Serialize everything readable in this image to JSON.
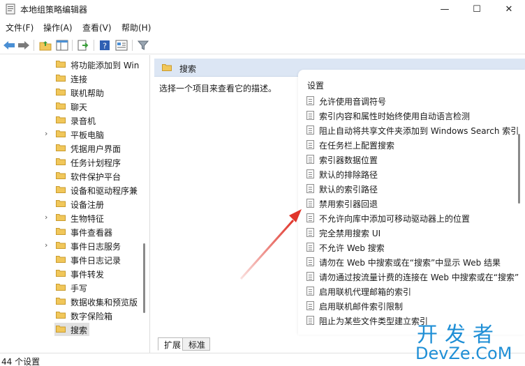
{
  "window": {
    "title": "本地组策略编辑器",
    "controls": {
      "minimize": "—",
      "maximize": "☐",
      "close": "✕"
    },
    "app_icon": "policy-editor-icon"
  },
  "menu": [
    {
      "label": "文件(F)"
    },
    {
      "label": "操作(A)"
    },
    {
      "label": "查看(V)"
    },
    {
      "label": "帮助(H)"
    }
  ],
  "toolbar": [
    {
      "icon": "back-arrow-icon"
    },
    {
      "icon": "forward-arrow-icon"
    },
    {
      "icon": "up-folder-icon"
    },
    {
      "icon": "show-hide-tree-icon"
    },
    {
      "icon": "export-list-icon"
    },
    {
      "icon": "help-icon"
    },
    {
      "icon": "properties-icon"
    },
    {
      "icon": "filter-icon"
    }
  ],
  "tree": {
    "items": [
      {
        "label": "将功能添加到 Win",
        "expandable": false
      },
      {
        "label": "连接",
        "expandable": false
      },
      {
        "label": "联机帮助",
        "expandable": false
      },
      {
        "label": "聊天",
        "expandable": false
      },
      {
        "label": "录音机",
        "expandable": false
      },
      {
        "label": "平板电脑",
        "expandable": true
      },
      {
        "label": "凭据用户界面",
        "expandable": false
      },
      {
        "label": "任务计划程序",
        "expandable": false
      },
      {
        "label": "软件保护平台",
        "expandable": false
      },
      {
        "label": "设备和驱动程序兼",
        "expandable": false
      },
      {
        "label": "设备注册",
        "expandable": false
      },
      {
        "label": "生物特征",
        "expandable": true
      },
      {
        "label": "事件查看器",
        "expandable": false
      },
      {
        "label": "事件日志服务",
        "expandable": true
      },
      {
        "label": "事件日志记录",
        "expandable": false
      },
      {
        "label": "事件转发",
        "expandable": false
      },
      {
        "label": "手写",
        "expandable": false
      },
      {
        "label": "数据收集和预览版",
        "expandable": false
      },
      {
        "label": "数字保险箱",
        "expandable": false
      },
      {
        "label": "搜索",
        "expandable": false,
        "selected": true
      }
    ]
  },
  "content": {
    "header": "搜索",
    "description": "选择一个项目来查看它的描述。",
    "settings_heading": "设置",
    "settings": [
      "允许使用音调符号",
      "索引内容和属性时始终使用自动语言检测",
      "阻止自动将共享文件夹添加到 Windows Search 索引",
      "在任务栏上配置搜索",
      "索引器数据位置",
      "默认的排除路径",
      "默认的索引路径",
      "禁用索引器回退",
      "不允许向库中添加可移动驱动器上的位置",
      "完全禁用搜索 UI",
      "不允许 Web 搜索",
      "请勿在 Web 中搜索或在“搜索”中显示 Web 结果",
      "请勿通过按流量计费的连接在 Web 中搜索或在“搜索”",
      "启用联机代理邮箱的索引",
      "启用联机邮件索引限制",
      "阻止为某些文件类型建立索引"
    ]
  },
  "tabs": [
    {
      "label": "扩展"
    },
    {
      "label": "标准"
    }
  ],
  "status": {
    "text": "44 个设置"
  },
  "annotation": {
    "color": "#e0352b",
    "points_to_setting": "禁用索引器回退"
  },
  "watermark": {
    "line1": "开发者",
    "line2": "DevZe.CoM",
    "color": "#1f8fd6"
  }
}
